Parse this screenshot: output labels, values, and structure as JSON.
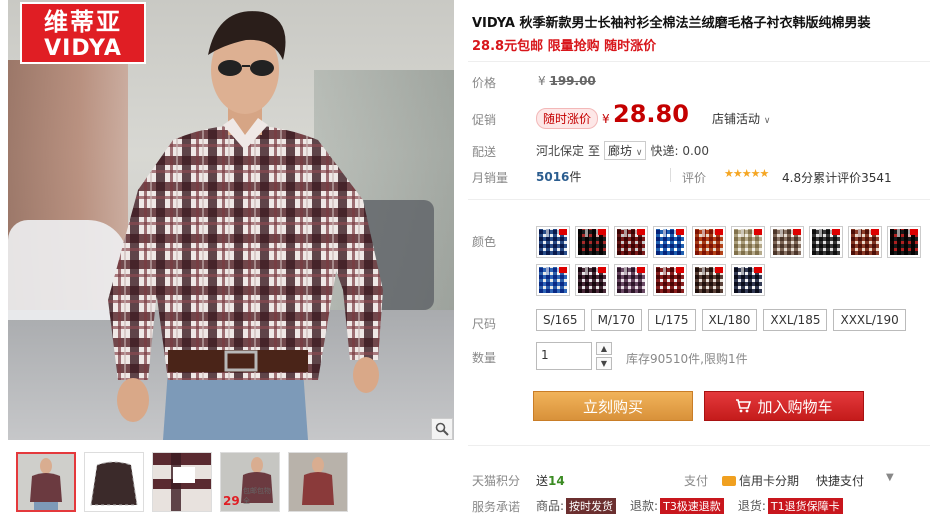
{
  "brand": {
    "logo_cn": "维蒂亚",
    "logo_en": "VIDYA"
  },
  "product": {
    "title": "VIDYA 秋季新款男士长袖衬衫全棉法兰绒磨毛格子衬衣韩版纯棉男装",
    "subtitle": "28.8元包邮 限量抢购 随时涨价"
  },
  "labels": {
    "price": "价格",
    "promo": "促销",
    "delivery": "配送",
    "monthly_sales": "月销量",
    "rating": "评价",
    "color": "颜色",
    "size": "尺码",
    "quantity": "数量",
    "tmall_points": "天猫积分",
    "pay": "支付",
    "service": "服务承诺"
  },
  "price": {
    "original_prefix": "¥",
    "original": "199.00",
    "promo_tag": "随时涨价",
    "currency": "¥",
    "sale": "28.80",
    "store_activity": "店铺活动"
  },
  "delivery": {
    "from": "河北保定",
    "to_word": "至",
    "city": "廊坊",
    "shipping_fee": "快递: 0.00"
  },
  "sales": {
    "count": "5016",
    "unit": "件"
  },
  "rating": {
    "stars": "★★★★★",
    "score_text": "4.8分累计评价3541"
  },
  "colors": [
    {
      "c1": "#2a4e8a",
      "c2": "#e8ecf2"
    },
    {
      "c1": "#1c1c1c",
      "c2": "#a82a2a"
    },
    {
      "c1": "#7a1a1a",
      "c2": "#c9c9c9"
    },
    {
      "c1": "#1e5fb0",
      "c2": "#ffffff"
    },
    {
      "c1": "#b4431a",
      "c2": "#e8d8cc"
    },
    {
      "c1": "#b5a98a",
      "c2": "#f0ede2"
    },
    {
      "c1": "#8a7466",
      "c2": "#e6ddd4"
    },
    {
      "c1": "#3b3b3b",
      "c2": "#e2e2e2"
    },
    {
      "c1": "#8c3d2a",
      "c2": "#ead7c8"
    },
    {
      "c1": "#1a1a1a",
      "c2": "#b02020"
    },
    {
      "c1": "#2f66b8",
      "c2": "#eaeaea"
    },
    {
      "c1": "#4a2a3a",
      "c2": "#e6e6e6"
    },
    {
      "c1": "#6b4a66",
      "c2": "#e9e0e6"
    },
    {
      "c1": "#8a1f1f",
      "c2": "#f0f0f0"
    },
    {
      "c1": "#5a4038",
      "c2": "#e8e2da"
    },
    {
      "c1": "#333a55",
      "c2": "#f2f2f2"
    }
  ],
  "sizes": [
    "S/165",
    "M/170",
    "L/175",
    "XL/180",
    "XXL/185",
    "XXXL/190"
  ],
  "quantity": {
    "value": "1",
    "stock": "库存90510件,限购1件"
  },
  "buttons": {
    "buy_now": "立刻购买",
    "add_cart": "加入购物车"
  },
  "points": {
    "prefix": "送",
    "value": "14"
  },
  "payment": {
    "credit": "信用卡分期",
    "quick": "快捷支付"
  },
  "services": [
    {
      "label": "商品:",
      "badge": "按时发货",
      "style": "dark"
    },
    {
      "label": "退款:",
      "badge": "T3极速退款",
      "style": "red"
    },
    {
      "label": "退货:",
      "badge": "T1退货保障卡",
      "style": "red"
    }
  ],
  "thumbnails": [
    {
      "badge": ""
    },
    {
      "badge": ""
    },
    {
      "badge": ""
    },
    {
      "badge": "29",
      "small": "包邮包物 全"
    },
    {
      "badge": ""
    }
  ]
}
